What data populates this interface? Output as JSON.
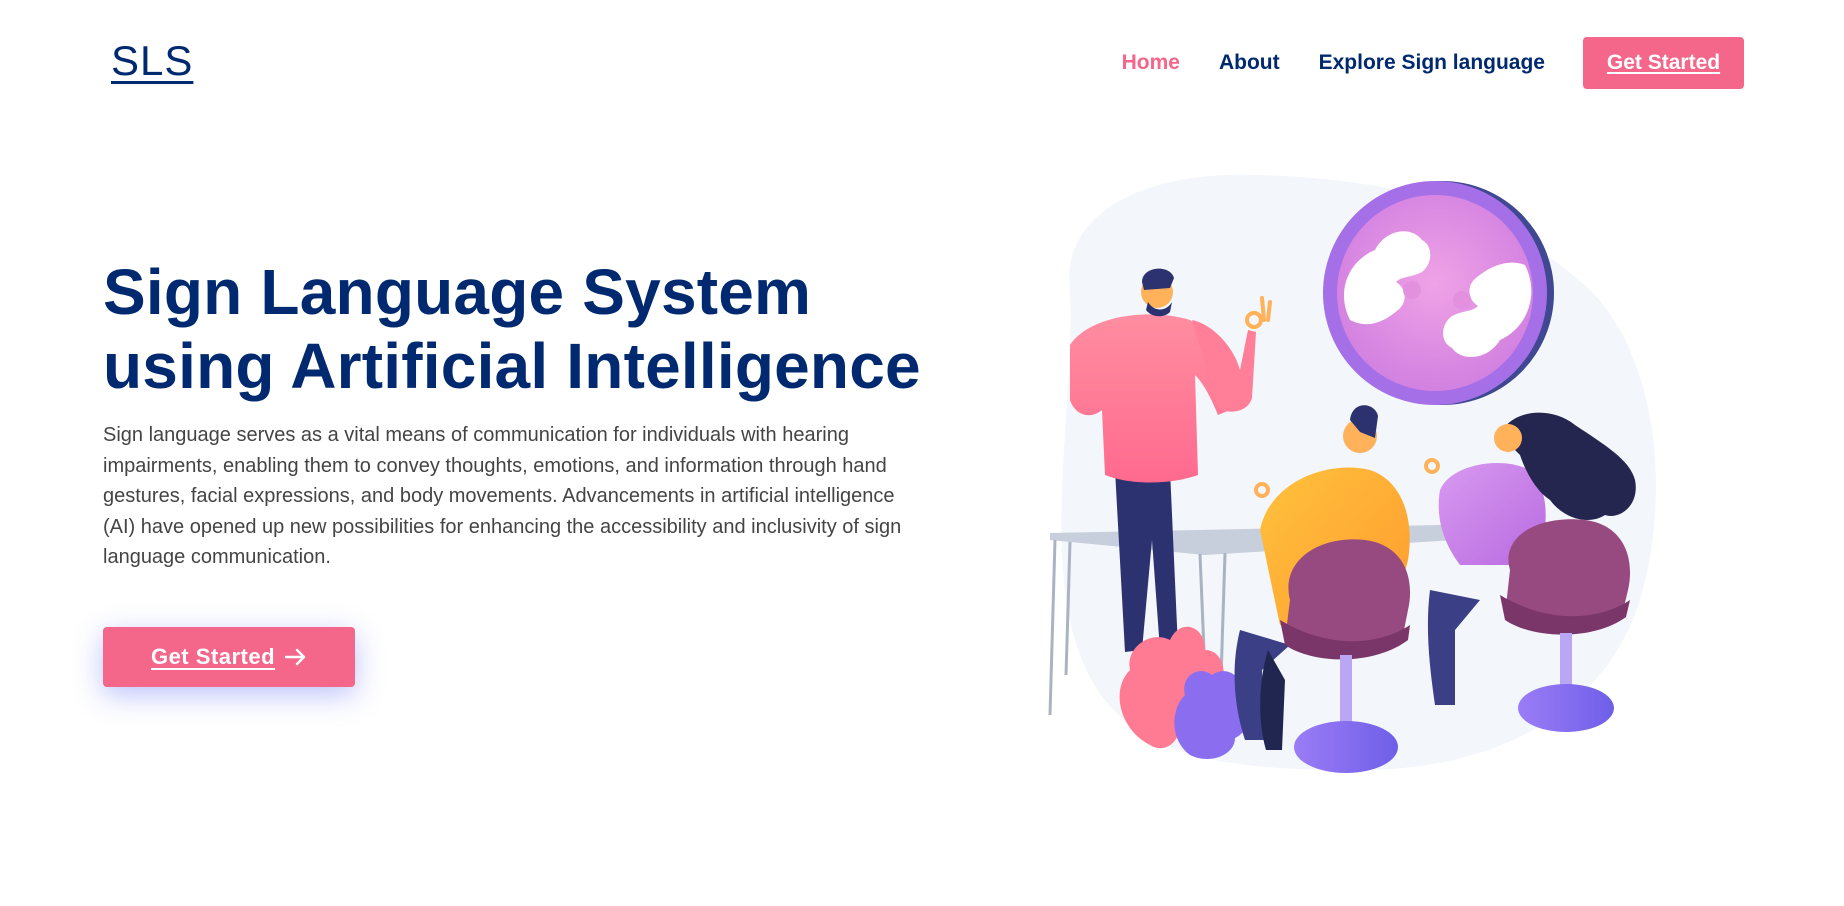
{
  "header": {
    "logo": "SLS",
    "nav": [
      {
        "label": "Home",
        "active": true
      },
      {
        "label": "About",
        "active": false
      },
      {
        "label": "Explore Sign language",
        "active": false
      }
    ],
    "cta_label": "Get Started"
  },
  "hero": {
    "title_line1": "Sign Language System",
    "title_line2": "using Artificial Intelligence",
    "description": "Sign language serves as a vital means of communication for individuals with hearing impairments, enabling them to convey thoughts, emotions, and information through hand gestures, facial expressions, and body movements. Advancements in artificial intelligence (AI) have opened up new possibilities for enhancing the accessibility and inclusivity of sign language communication.",
    "cta_label": "Get Started",
    "cta_icon": "arrow-right-icon"
  },
  "illustration": {
    "name": "sign-language-meeting-illustration"
  },
  "colors": {
    "brand": "#012970",
    "accent": "#f4668a",
    "text": "#444444",
    "shadow": "#4154f1"
  }
}
